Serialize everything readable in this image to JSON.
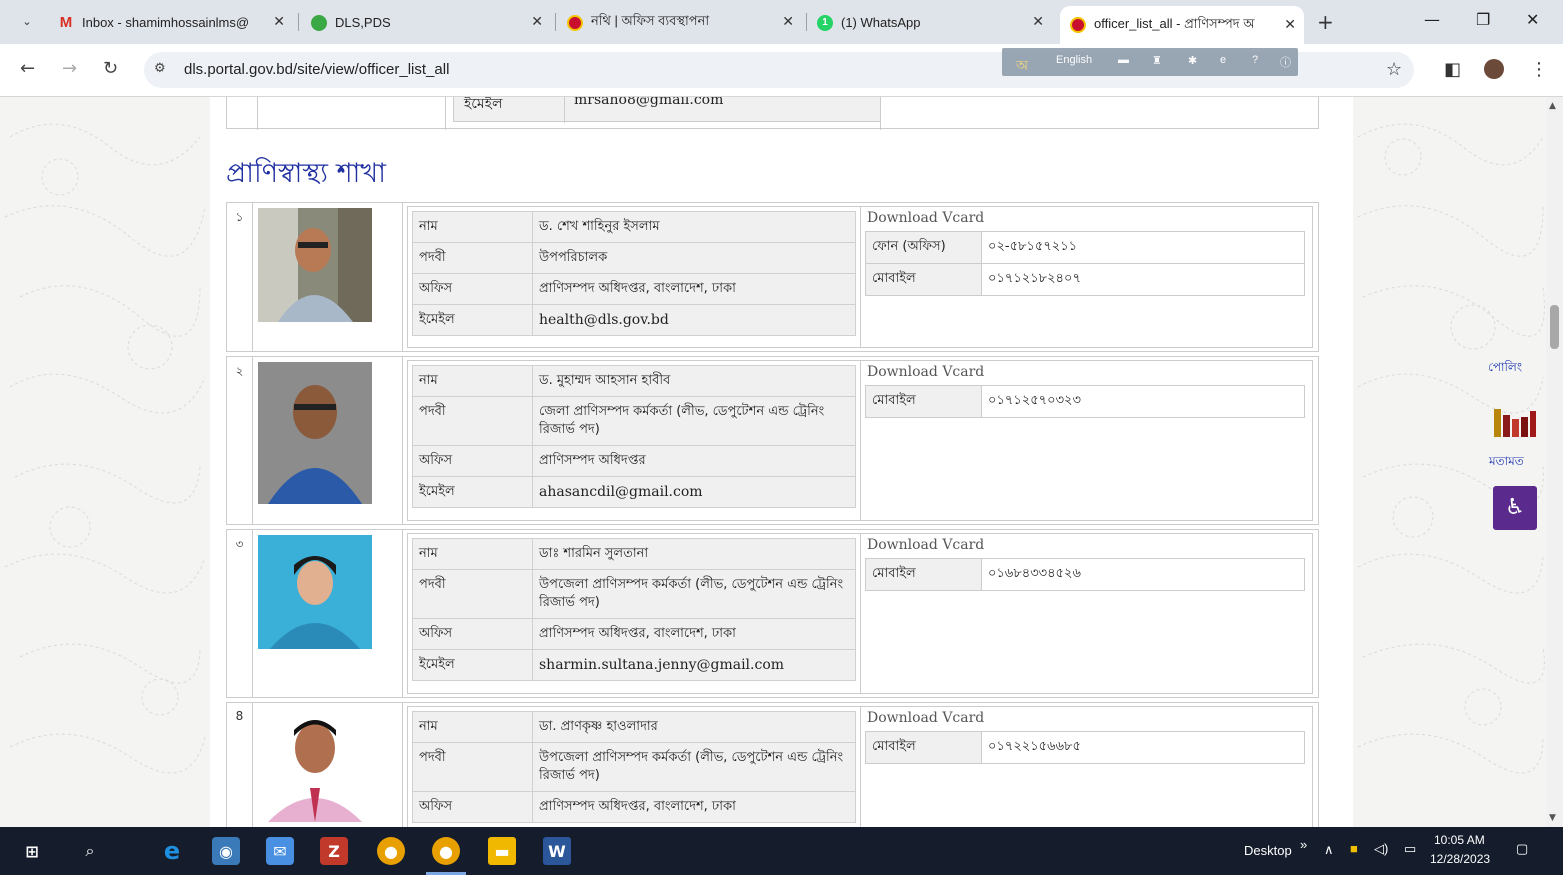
{
  "browser": {
    "tabs": [
      {
        "title": "Inbox - shamimhossainlms@",
        "favicon": "gmail-icon",
        "color": "#d93025"
      },
      {
        "title": "DLS,PDS",
        "favicon": "edge-icon",
        "color": "#3aa845"
      },
      {
        "title": "নথি | অফিস ব্যবস্থাপনা",
        "favicon": "dls-icon",
        "color": "#c8102e"
      },
      {
        "title": "(1) WhatsApp",
        "favicon": "whatsapp-icon",
        "color": "#25d366"
      },
      {
        "title": "officer_list_all - প্রাণিসম্পদ অ",
        "favicon": "dls-icon",
        "color": "#c8102e"
      }
    ],
    "url": "dls.portal.gov.bd/site/view/officer_list_all",
    "language_widget": "English"
  },
  "page": {
    "previous_row": {
      "label": "ইমেইল",
      "value": "mrsaho8@gmail.com"
    },
    "section_title": "প্রাণিস্বাস্থ্য শাখা",
    "labels": {
      "name": "নাম",
      "designation": "পদবী",
      "office": "অফিস",
      "email": "ইমেইল",
      "vcard": "Download Vcard",
      "phone_office": "ফোন (অফিস)",
      "mobile": "মোবাইল"
    },
    "officers": [
      {
        "serial": "১",
        "name": "ড. শেখ শাহিনুর ইসলাম",
        "designation": "উপপরিচালক",
        "office": "প্রাণিসম্পদ অধিদপ্তর, বাংলাদেশ, ঢাকা",
        "email": "health@dls.gov.bd",
        "phone_office": "০২-৫৮১৫৭২১১",
        "mobile": "০১৭১২১৮২৪০৭"
      },
      {
        "serial": "২",
        "name": "ড. মুহাম্মদ আহসান হাবীব",
        "designation": "জেলা প্রাণিসম্পদ কর্মকর্তা (লীভ, ডেপুটেশন এন্ড ট্রেনিং রিজার্ভ পদ)",
        "office": "প্রাণিসম্পদ অধিদপ্তর",
        "email": "ahasancdil@gmail.com",
        "mobile": "০১৭১২৫৭০৩২৩"
      },
      {
        "serial": "৩",
        "name": "ডাঃ শারমিন সুলতানা",
        "designation": "উপজেলা প্রাণিসম্পদ কর্মকর্তা (লীভ, ডেপুটেশন এন্ড ট্রেনিং রিজার্ভ পদ)",
        "office": "প্রাণিসম্পদ অধিদপ্তর, বাংলাদেশ, ঢাকা",
        "email": "sharmin.sultana.jenny@gmail.com",
        "mobile": "০১৬৮৪৩৩৪৫২৬"
      },
      {
        "serial": "8",
        "name": "ডা. প্রাণকৃষ্ণ হাওলাদার",
        "designation": "উপজেলা প্রাণিসম্পদ কর্মকর্তা (লীভ, ডেপুটেশন এন্ড ট্রেনিং রিজার্ভ পদ)",
        "office": "প্রাণিসম্পদ অধিদপ্তর, বাংলাদেশ, ঢাকা",
        "mobile": "০১৭২২১৫৬৬৮৫"
      }
    ],
    "side": {
      "poll": "পোলিং",
      "feedback": "মতামত"
    }
  },
  "taskbar": {
    "desktop_label": "Desktop",
    "time": "10:05 AM",
    "date": "12/28/2023"
  },
  "colors": {
    "section_title": "#1f2fa0",
    "accessibility": "#5a2a8c",
    "taskbar": "#151d2c"
  }
}
